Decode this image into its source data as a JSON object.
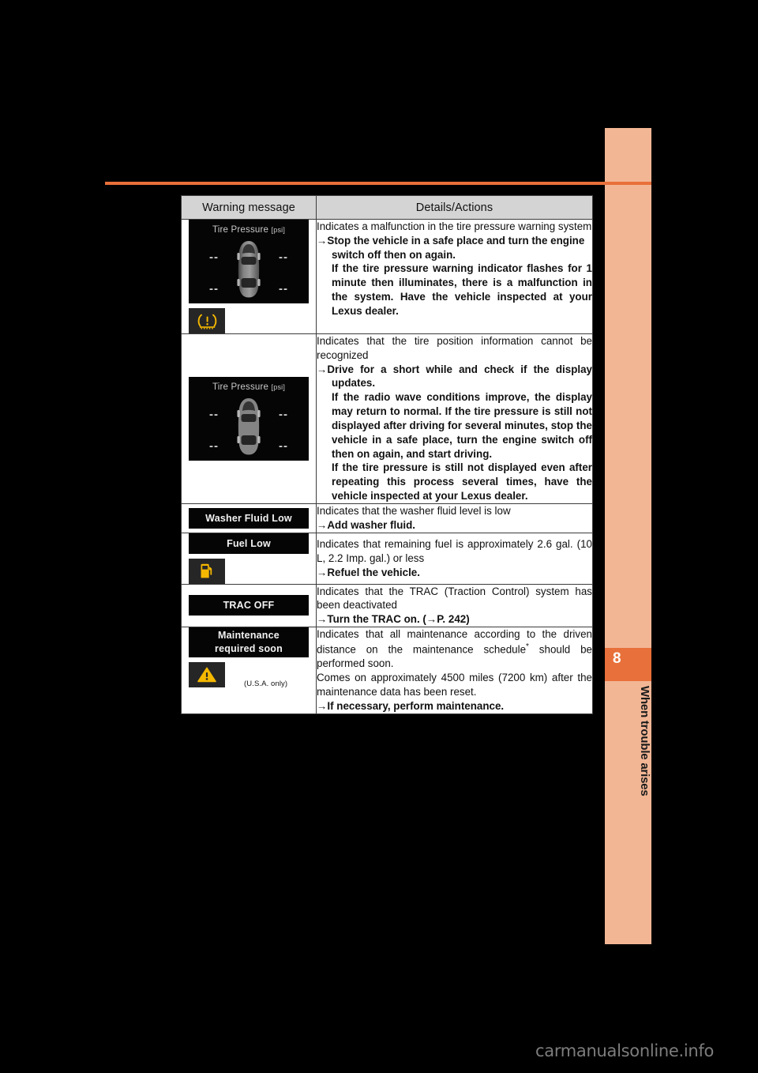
{
  "page": {
    "chapter_number": "8",
    "chapter_title": "When trouble arises",
    "watermark": "carmanualsonline.info",
    "accent_color": "#e8703a",
    "tab_color": "#f2b695"
  },
  "table": {
    "headers": {
      "warning_message": "Warning message",
      "details_actions": "Details/Actions"
    },
    "rows": [
      {
        "id": "tire-pressure-malfunction",
        "display_title": "Tire Pressure",
        "display_unit": "[psi]",
        "tire_values": [
          "--",
          "--",
          "--",
          "--"
        ],
        "telltale_icon": "tire-pressure-warning-icon",
        "details_intro": "Indicates a malfunction in the tire pressure warning system",
        "action_arrow": "→",
        "action": "Stop the vehicle in a safe place and turn the engine switch off then on again.",
        "action_cont": "If the tire pressure warning indicator flashes for 1 minute then illuminates, there is a malfunction in the system. Have the vehicle inspected at your Lexus dealer."
      },
      {
        "id": "tire-position-unrecognized",
        "display_title": "Tire Pressure",
        "display_unit": "[psi]",
        "tire_values": [
          "--",
          "--",
          "--",
          "--"
        ],
        "details_intro": "Indicates that the tire position information cannot be recognized",
        "action_arrow": "→",
        "action": "Drive for a short while and check if the display updates.",
        "action_cont": "If the radio wave conditions improve, the display may return to normal. If the tire pressure is still not displayed after driving for several minutes, stop the vehicle in a safe place, turn the engine switch off then on again, and start driving.",
        "action_cont2": "If the tire pressure is still not displayed even after repeating this process several times, have the vehicle inspected at your Lexus dealer."
      },
      {
        "id": "washer-fluid-low",
        "message": "Washer Fluid Low",
        "details_intro": "Indicates that the washer fluid level is low",
        "action_arrow": "→",
        "action": "Add washer fluid."
      },
      {
        "id": "fuel-low",
        "message": "Fuel Low",
        "telltale_icon": "fuel-pump-icon",
        "details_intro": "Indicates that remaining fuel is approximately 2.6 gal. (10 L, 2.2 Imp. gal.) or less",
        "action_arrow": "→",
        "action": "Refuel the vehicle."
      },
      {
        "id": "trac-off",
        "message": "TRAC OFF",
        "details_intro": "Indicates that the TRAC (Traction Control) system has been deactivated",
        "action_arrow": "→",
        "action": "Turn the TRAC on. (→P. 242)"
      },
      {
        "id": "maintenance-required-soon",
        "message_line1": "Maintenance",
        "message_line2": "required soon",
        "telltale_icon": "master-warning-triangle-icon",
        "note": "(U.S.A. only)",
        "details_intro": "Indicates that all maintenance according to the driven distance on the maintenance schedule",
        "details_footnote_marker": "*",
        "details_intro_cont": " should be performed soon.",
        "details_second": "Comes on approximately 4500 miles (7200 km) after the maintenance data has been reset.",
        "action_arrow": "→",
        "action": "If necessary, perform maintenance."
      }
    ]
  }
}
